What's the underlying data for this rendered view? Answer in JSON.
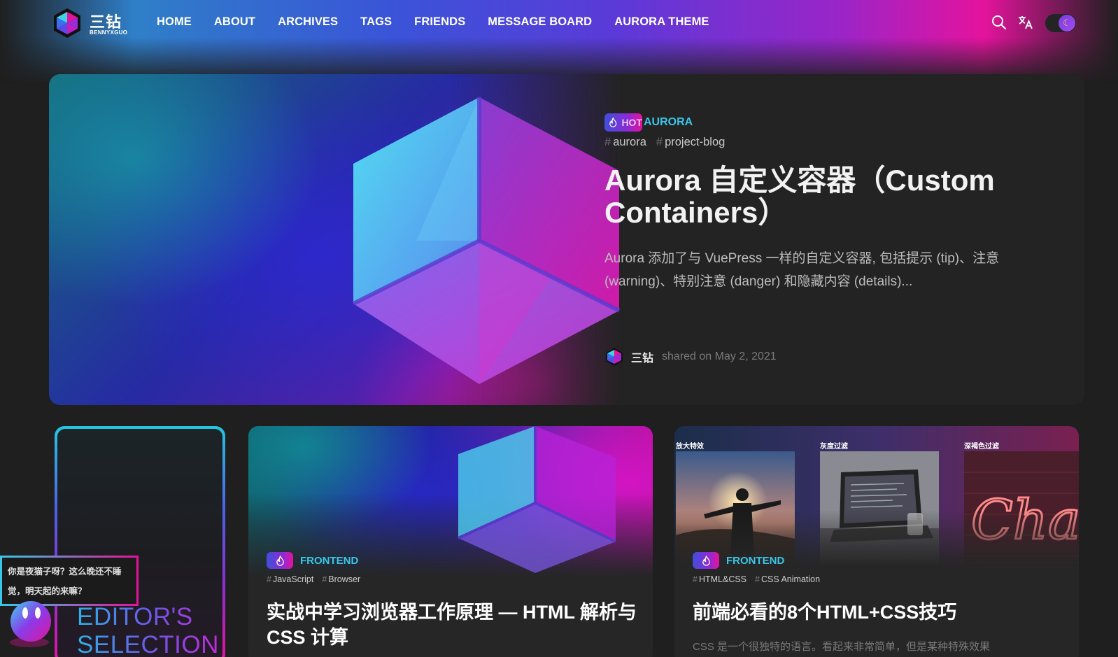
{
  "brand": {
    "name": "三钻",
    "sub": "BENNYXGUO"
  },
  "nav": {
    "items": [
      {
        "label": "HOME"
      },
      {
        "label": "ABOUT"
      },
      {
        "label": "ARCHIVES"
      },
      {
        "label": "TAGS"
      },
      {
        "label": "FRIENDS"
      },
      {
        "label": "MESSAGE BOARD"
      },
      {
        "label": "AURORA THEME"
      }
    ],
    "icons": [
      "search-icon",
      "translate-icon",
      "moon-icon"
    ]
  },
  "hero": {
    "badge": "HOT",
    "category": "AURORA",
    "tags": [
      "aurora",
      "project-blog"
    ],
    "title": "Aurora 自定义容器（Custom Containers）",
    "description": "Aurora 添加了与 VuePress 一样的自定义容器, 包括提示 (tip)、注意 (warning)、特别注意 (danger) 和隐藏内容 (details)...",
    "author": "三钻",
    "shared": "shared on May 2, 2021"
  },
  "editor": {
    "label_line1": "EDITOR'S",
    "label_line2": "SELECTION"
  },
  "posts": [
    {
      "category": "FRONTEND",
      "tags": [
        "JavaScript",
        "Browser"
      ],
      "title": "实战中学习浏览器工作原理 — HTML 解析与 CSS 计算"
    },
    {
      "category": "FRONTEND",
      "tags": [
        "HTML&CSS",
        "CSS Animation"
      ],
      "title": "前端必看的8个HTML+CSS技巧",
      "photo_labels": [
        "放大特效",
        "灰度过滤",
        "深褐色过滤"
      ],
      "description": "CSS 是一个很独特的语言。看起来非常简单，但是某种特殊效果"
    }
  ],
  "mascot": {
    "speech": "你是夜猫子呀？这么晚还不睡觉，明天起的来嘛？"
  },
  "colors": {
    "accent_cyan": "#39c6e8",
    "accent_pink": "#e4139d",
    "accent_purple": "#8a2bd8",
    "background": "#1f1f1f"
  }
}
